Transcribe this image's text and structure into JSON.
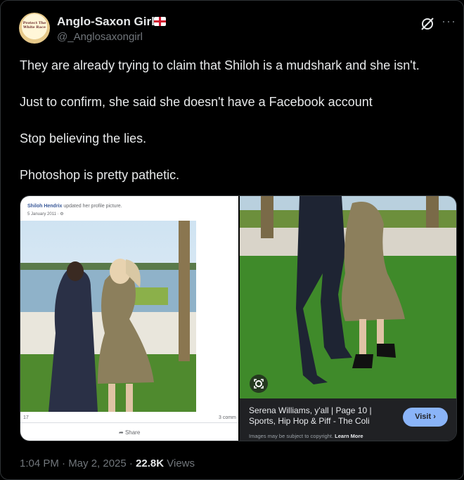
{
  "author": {
    "name": "Anglo-Saxon Girl",
    "handle": "@_Anglosaxongirl",
    "avatar_text": "Protect The White Race"
  },
  "tweet": {
    "lines": [
      "They are already trying to claim that Shiloh is a mudshark and she isn't.",
      "Just to confirm, she said she doesn't have a Facebook account",
      "Stop believing the lies.",
      "Photoshop is pretty pathetic."
    ]
  },
  "left_image": {
    "poster_name": "Shiloh Hendrix",
    "poster_action": "updated her profile picture.",
    "date": "5 January 2011 · ⚙",
    "reaction_count": "17",
    "comments": "3 comm",
    "share_label": "Share"
  },
  "right_image": {
    "title": "Serena Williams, y'all | Page 10 | Sports, Hip Hop & Piff - The Coli",
    "note": "Images may be subject to copyright.",
    "learn_more": "Learn More",
    "visit_label": "Visit ›"
  },
  "footer": {
    "time": "1:04 PM · May 2, 2025 · ",
    "views_count": "22.8K",
    "views_label": " Views"
  },
  "icons": [
    "grok-icon",
    "more-icon",
    "lens-icon",
    "share-icon"
  ],
  "colors": {
    "background": "#000000",
    "text": "#e7e9ea",
    "muted": "#71767b",
    "visit_button": "#8ab4f8"
  }
}
